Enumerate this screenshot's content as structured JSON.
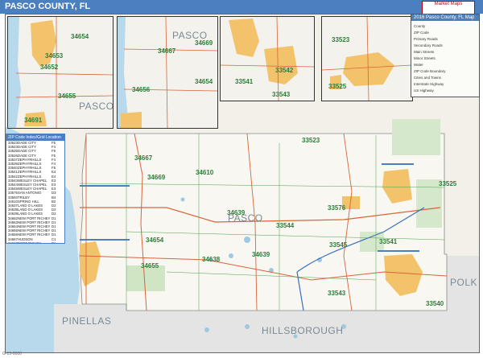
{
  "header": {
    "title": "PASCO COUNTY, FL",
    "logo_text": "Market Maps"
  },
  "legend": {
    "title": "2016 Pasco County, FL Map",
    "items": [
      "County",
      "ZIP Code",
      "Primary Roads",
      "Secondary Roads",
      "Main Streets",
      "Minor Streets",
      "Water",
      "ZIP Code Boundary",
      "Cities and Towns",
      "Interstate Highway",
      "US Highway"
    ]
  },
  "zip_table": {
    "title": "ZIP Code Index/Grid Location",
    "rows": [
      [
        "33523",
        "DADE CITY",
        "F5"
      ],
      [
        "33523",
        "DADE CITY",
        "F4"
      ],
      [
        "33525",
        "DADE CITY",
        "F5"
      ],
      [
        "33526",
        "DADE CITY",
        "F5"
      ],
      [
        "33537",
        "ZEPHYRHILLS",
        "F4"
      ],
      [
        "33539",
        "ZEPHYRHILLS",
        "F4"
      ],
      [
        "33540",
        "ZEPHYRHILLS",
        "F5"
      ],
      [
        "33541",
        "ZEPHYRHILLS",
        "E4"
      ],
      [
        "33542",
        "ZEPHYRHILLS",
        "E4"
      ],
      [
        "33543",
        "WESLEY CHAPEL",
        "E3"
      ],
      [
        "33544",
        "WESLEY CHAPEL",
        "E3"
      ],
      [
        "33545",
        "WESLEY CHAPEL",
        "E3"
      ],
      [
        "33576",
        "SAN ANTONIO",
        "D3"
      ],
      [
        "33593",
        "TRILBY",
        "B4"
      ],
      [
        "34610",
        "SPRING HILL",
        "B2"
      ],
      [
        "34637",
        "LAND O LAKES",
        "D2"
      ],
      [
        "34638",
        "LAND O LAKES",
        "D2"
      ],
      [
        "34639",
        "LAND O LAKES",
        "D2"
      ],
      [
        "34652",
        "NEW PORT RICHEY",
        "D1"
      ],
      [
        "34653",
        "NEW PORT RICHEY",
        "D1"
      ],
      [
        "34654",
        "NEW PORT RICHEY",
        "D1"
      ],
      [
        "34655",
        "NEW PORT RICHEY",
        "D1"
      ],
      [
        "34656",
        "NEW PORT RICHEY",
        "D1"
      ],
      [
        "34667",
        "HUDSON",
        "C1"
      ],
      [
        "34668",
        "PORT RICHEY",
        "D1"
      ],
      [
        "34669",
        "HUDSON",
        "C1"
      ],
      [
        "34673",
        "PORT RICHEY",
        "D1"
      ],
      [
        "34674",
        "HUDSON",
        "C1"
      ],
      [
        "34679",
        "ARIPEKA",
        "B1"
      ],
      [
        "34680",
        "ELFERS",
        "D1"
      ],
      [
        "34690",
        "HOLIDAY",
        "E1"
      ],
      [
        "34691",
        "HOLIDAY",
        "E1"
      ],
      [
        "34692",
        "HOLIDAY",
        "E1"
      ]
    ]
  },
  "insets": [
    {
      "zips": [
        "34654",
        "34653",
        "34655",
        "34652",
        "34691"
      ],
      "region": "PASCO"
    },
    {
      "zips": [
        "34667",
        "34669",
        "34654",
        "34656"
      ],
      "region": "PASCO"
    },
    {
      "zips": [
        "33541",
        "33542",
        "33543"
      ]
    },
    {
      "zips": [
        "33523",
        "33525"
      ]
    }
  ],
  "main_map": {
    "zips": [
      "33523",
      "34667",
      "34669",
      "34610",
      "33525",
      "33576",
      "34639",
      "33544",
      "34654",
      "34655",
      "34638",
      "34639",
      "33545",
      "33541",
      "33543",
      "33540"
    ],
    "regions": [
      "PASCO",
      "PINELLAS",
      "HILLSBOROUGH",
      "POLK"
    ]
  },
  "footer": "G-15-0000"
}
